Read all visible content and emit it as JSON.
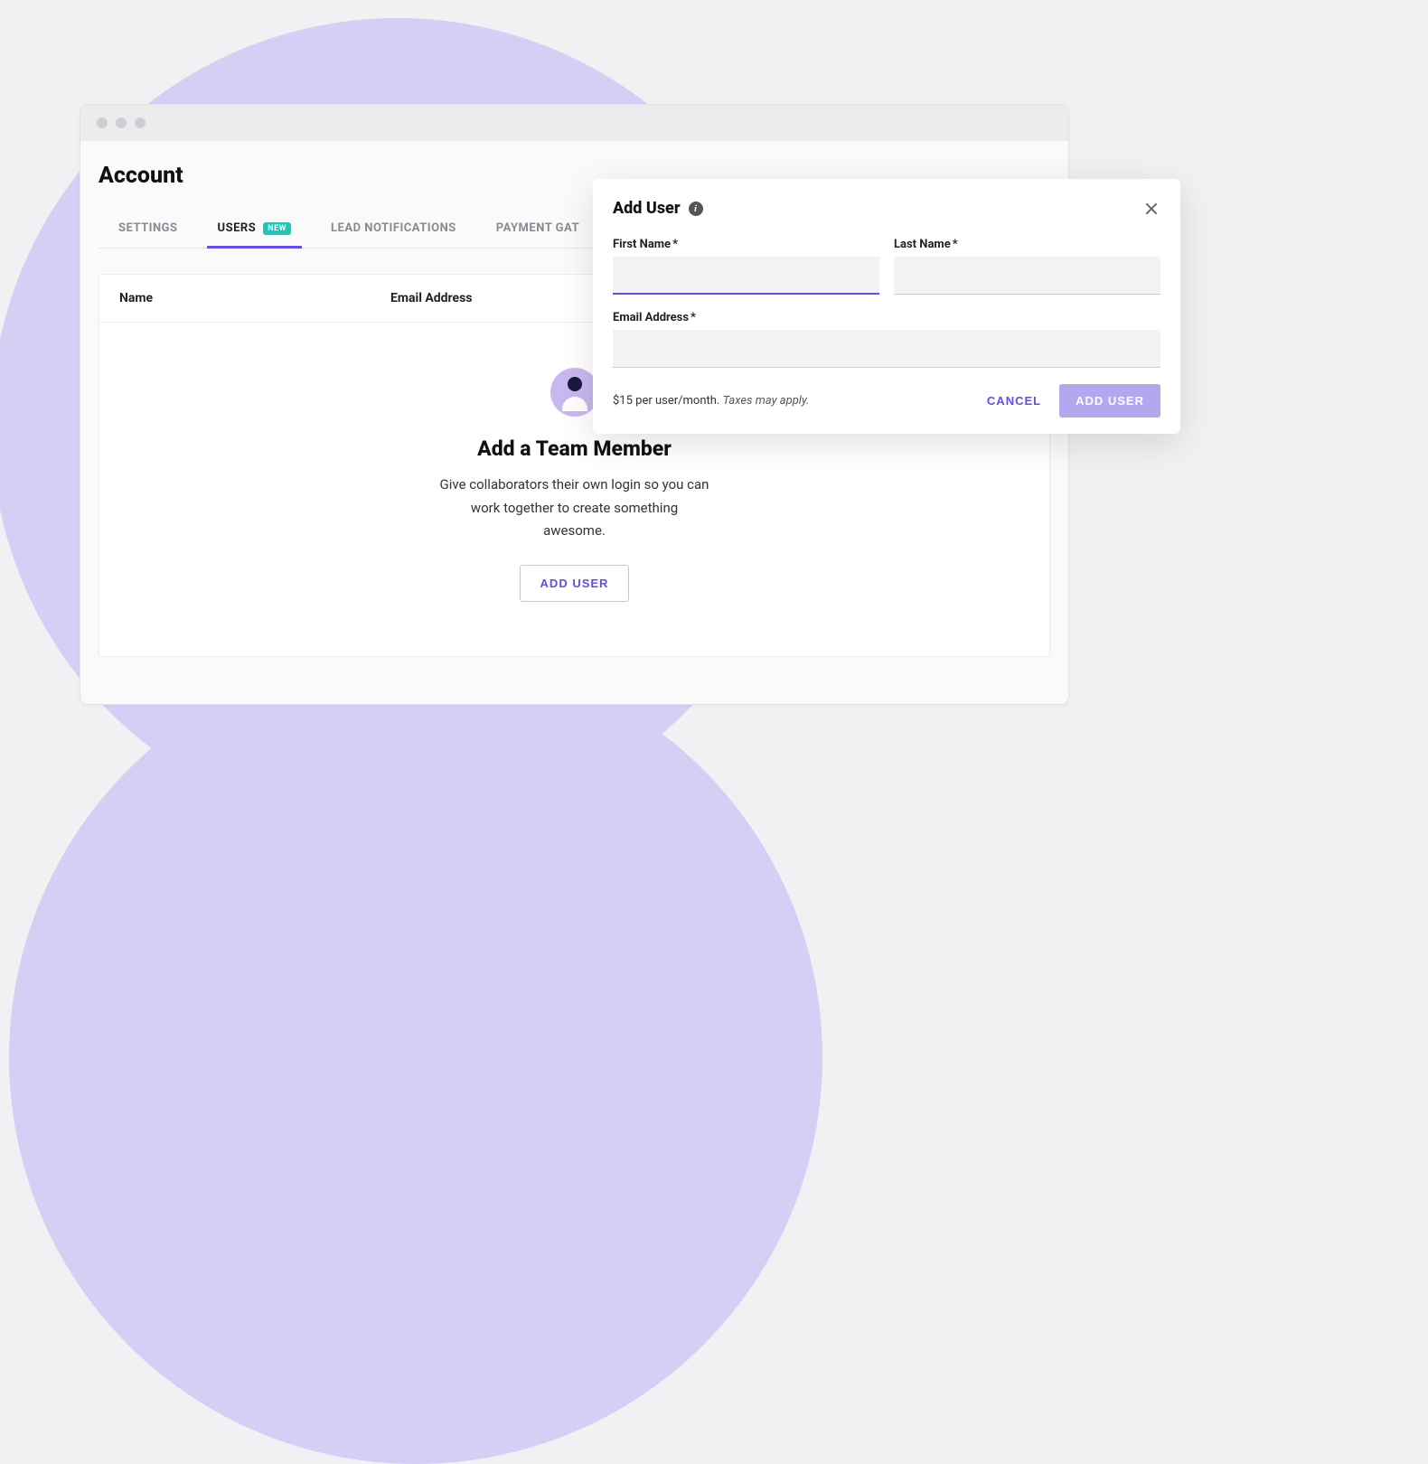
{
  "page": {
    "title": "Account"
  },
  "tabs": {
    "settings": "SETTINGS",
    "users": "USERS",
    "users_badge": "NEW",
    "lead_notifications": "LEAD NOTIFICATIONS",
    "payment_gateway": "PAYMENT GAT"
  },
  "table": {
    "col_name": "Name",
    "col_email": "Email Address"
  },
  "empty": {
    "title": "Add a Team Member",
    "desc": "Give collaborators their own login so you can work together to create something awesome.",
    "button": "ADD USER"
  },
  "modal": {
    "title": "Add User",
    "first_name_label": "First Name",
    "last_name_label": "Last Name",
    "email_label": "Email Address",
    "required_mark": "*",
    "price_note": "$15 per user/month.",
    "tax_note": "Taxes may apply.",
    "cancel": "CANCEL",
    "submit": "ADD USER"
  }
}
